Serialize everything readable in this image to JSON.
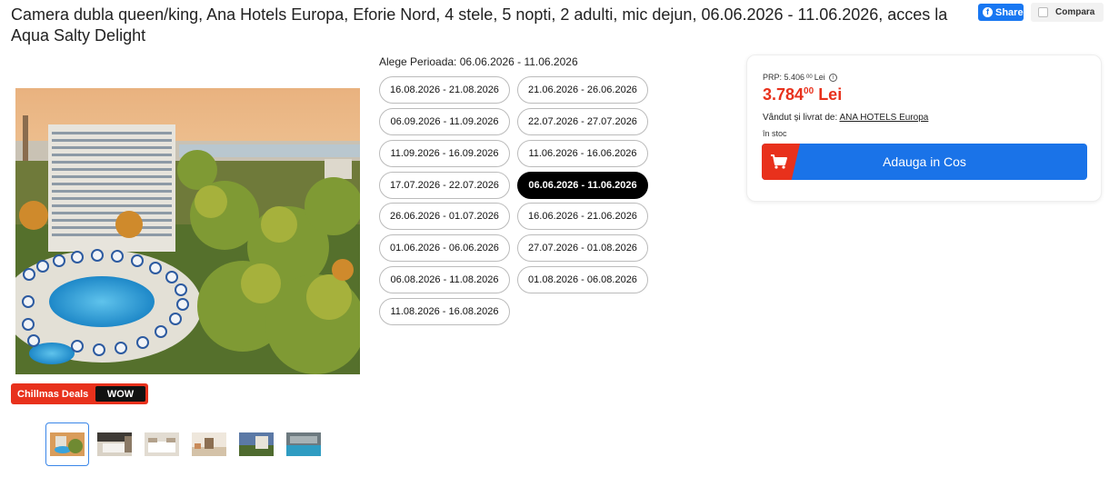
{
  "product": {
    "title": "Camera dubla queen/king, Ana Hotels Europa, Eforie Nord, 4 stele, 5 nopti, 2 adulti, mic dejun, 06.06.2026 - 11.06.2026, acces la Aqua Salty Delight"
  },
  "header": {
    "share_label": "Share",
    "compare_label": "Compara"
  },
  "promo": {
    "label": "Chillmas Deals",
    "tag": "WOW"
  },
  "gallery": {
    "thumbnails": [
      {
        "icon": "hotel-thumbnail-icon",
        "active": true
      },
      {
        "icon": "bedroom-thumbnail-icon",
        "active": false
      },
      {
        "icon": "bedroom2-thumbnail-icon",
        "active": false
      },
      {
        "icon": "lounge-thumbnail-icon",
        "active": false
      },
      {
        "icon": "exterior-thumbnail-icon",
        "active": false
      },
      {
        "icon": "pool-thumbnail-icon",
        "active": false
      }
    ]
  },
  "periods": {
    "label": "Alege Perioada: 06.06.2026 - 11.06.2026",
    "options": [
      "16.08.2026 - 21.08.2026",
      "21.06.2026 - 26.06.2026",
      "06.09.2026 - 11.09.2026",
      "22.07.2026 - 27.07.2026",
      "11.09.2026 - 16.09.2026",
      "11.06.2026 - 16.06.2026",
      "17.07.2026 - 22.07.2026",
      "06.06.2026 - 11.06.2026",
      "26.06.2026 - 01.07.2026",
      "16.06.2026 - 21.06.2026",
      "01.06.2026 - 06.06.2026",
      "27.07.2026 - 01.08.2026",
      "06.08.2026 - 11.08.2026",
      "01.08.2026 - 06.08.2026",
      "11.08.2026 - 16.08.2026"
    ],
    "selected": "06.06.2026 - 11.06.2026"
  },
  "pricing": {
    "prp_label": "PRP: 5.406",
    "prp_decimals": "00",
    "prp_currency": "Lei",
    "price_main": "3.784",
    "price_decimals": "00",
    "price_currency": "Lei",
    "seller_label": "Vândut și livrat de:",
    "seller_name": "ANA HOTELS Europa",
    "stock": "în stoc",
    "cart_button": "Adauga in Cos"
  },
  "colors": {
    "accent_blue": "#1a73e8",
    "price_red": "#e8311c",
    "facebook_blue": "#1877f2"
  }
}
